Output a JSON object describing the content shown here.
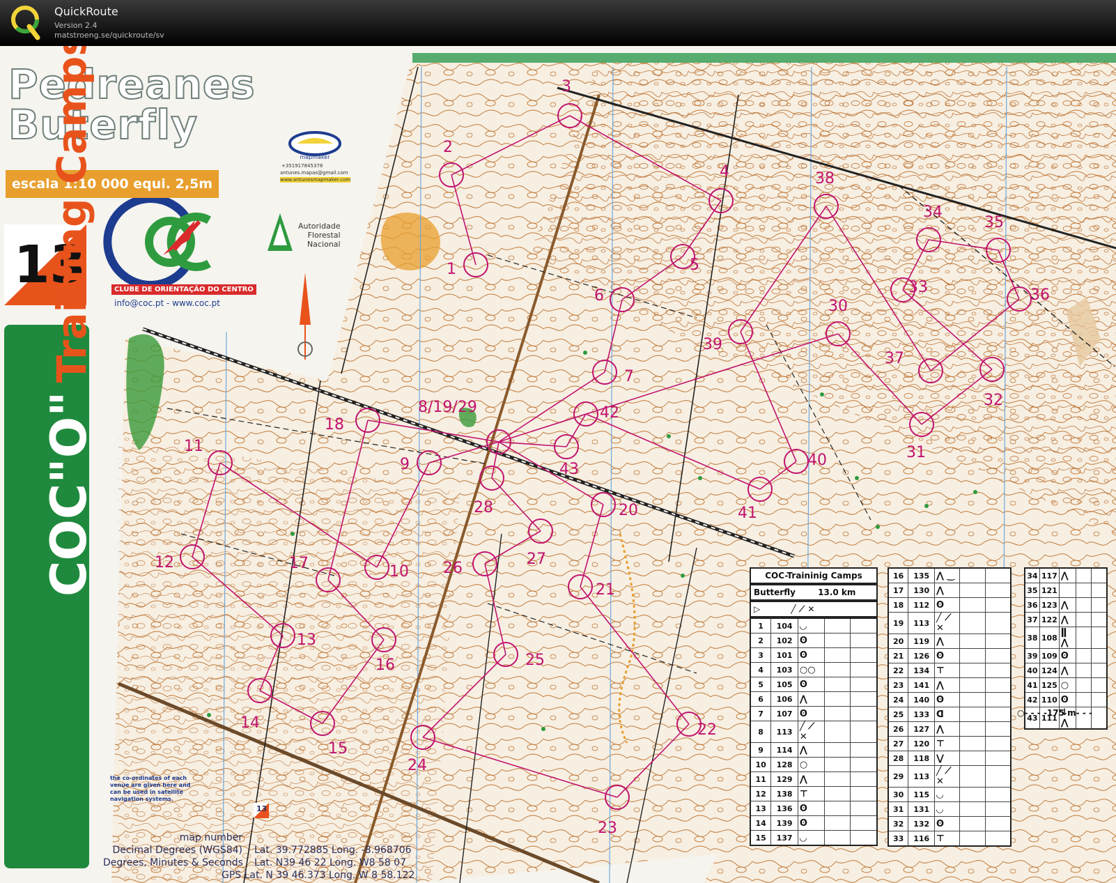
{
  "app": {
    "name": "QuickRoute",
    "version": "Version 2.4",
    "url": "matstroeng.se/quickroute/sv",
    "logo_icon": "quickroute-q-logo-icon"
  },
  "map": {
    "title_line1": "Pedreanes",
    "title_line2": "Buterfly",
    "scale_text": "escala 1:10 000  equi. 2,5m",
    "map_number": "13",
    "club": {
      "caption_prefix": "CLUBE DE ",
      "caption_rest": "ORIENTAÇÃO DO CENTRO",
      "contact": "info@coc.pt  -  www.coc.pt"
    },
    "authority": {
      "line1": "Autoridade",
      "line2": "Florestal",
      "line3": "Nacional"
    },
    "mapmaker": {
      "phone": "+351917845378",
      "email": "antunes.mapas@gmail.com",
      "web": "www.antunesmapmaker.com"
    },
    "banner": {
      "brand": "COC\"O\"",
      "rest": "Training Camps"
    },
    "coord_note": "the co-ordinates of each venue are given here and can be used in satellite navigation systems.",
    "coords": {
      "map_number_label": "map number",
      "map_number_value": "13",
      "decimal_label": "Decimal Degrees (WGS84)",
      "decimal_value": "Lat. 39.772885  Long. -8.968706",
      "dms_label": "Degrees, Minutes & Seconds",
      "dms_value": "Lat. N39 46 22  Long. W8 58 07",
      "gps_value": "GPS Lat. N 39 46.373  Long. W 8 58.122"
    },
    "colors": {
      "course": "#c0136e",
      "contour": "#b5651d",
      "vegetation": "#2f9b3f",
      "orange": "#e89f2e"
    }
  },
  "controls": [
    {
      "n": "1",
      "label": "1"
    },
    {
      "n": "2",
      "label": "2"
    },
    {
      "n": "3",
      "label": "3"
    },
    {
      "n": "4",
      "label": "4"
    },
    {
      "n": "5",
      "label": "5"
    },
    {
      "n": "6",
      "label": "6"
    },
    {
      "n": "7",
      "label": "7"
    },
    {
      "n": "8",
      "label": "8/19/29"
    },
    {
      "n": "9",
      "label": "9"
    },
    {
      "n": "10",
      "label": "10"
    },
    {
      "n": "11",
      "label": "11"
    },
    {
      "n": "12",
      "label": "12"
    },
    {
      "n": "13",
      "label": "13"
    },
    {
      "n": "14",
      "label": "14"
    },
    {
      "n": "15",
      "label": "15"
    },
    {
      "n": "16",
      "label": "16"
    },
    {
      "n": "17",
      "label": "17"
    },
    {
      "n": "18",
      "label": "18"
    },
    {
      "n": "20",
      "label": "20"
    },
    {
      "n": "21",
      "label": "21"
    },
    {
      "n": "22",
      "label": "22"
    },
    {
      "n": "23",
      "label": "23"
    },
    {
      "n": "24",
      "label": "24"
    },
    {
      "n": "25",
      "label": "25"
    },
    {
      "n": "26",
      "label": "26"
    },
    {
      "n": "27",
      "label": "27"
    },
    {
      "n": "28",
      "label": "28"
    },
    {
      "n": "30",
      "label": "30"
    },
    {
      "n": "31",
      "label": "31"
    },
    {
      "n": "32",
      "label": "32"
    },
    {
      "n": "33",
      "label": "33"
    },
    {
      "n": "34",
      "label": "34"
    },
    {
      "n": "35",
      "label": "35"
    },
    {
      "n": "36",
      "label": "36"
    },
    {
      "n": "37",
      "label": "37"
    },
    {
      "n": "38",
      "label": "38"
    },
    {
      "n": "39",
      "label": "39"
    },
    {
      "n": "40",
      "label": "40"
    },
    {
      "n": "41",
      "label": "41"
    },
    {
      "n": "42",
      "label": "42"
    },
    {
      "n": "43",
      "label": "43"
    }
  ],
  "descriptions": {
    "header_title": "COC-Traininig Camps",
    "course_name": "Butterfly",
    "course_length": "13.0 km",
    "start_symbol": "▷",
    "table1": [
      [
        "1",
        "104",
        "◡"
      ],
      [
        "2",
        "102",
        "ʘ"
      ],
      [
        "3",
        "101",
        "ʘ"
      ],
      [
        "4",
        "103",
        "○○"
      ],
      [
        "5",
        "105",
        "ʘ"
      ],
      [
        "6",
        "106",
        "⋀"
      ],
      [
        "7",
        "107",
        "ʘ"
      ],
      [
        "8",
        "113",
        "╱ ⟋ ✕"
      ],
      [
        "9",
        "114",
        "⋀"
      ],
      [
        "10",
        "128",
        "○"
      ],
      [
        "11",
        "129",
        "⋀"
      ],
      [
        "12",
        "138",
        "⊤"
      ],
      [
        "13",
        "136",
        "ʘ"
      ],
      [
        "14",
        "139",
        "ʘ"
      ],
      [
        "15",
        "137",
        "◡"
      ]
    ],
    "table2": [
      [
        "16",
        "135",
        "⋀ ‿"
      ],
      [
        "17",
        "130",
        "⋀"
      ],
      [
        "18",
        "112",
        "ʘ"
      ],
      [
        "19",
        "113",
        "╱ ⟋ ✕"
      ],
      [
        "20",
        "119",
        "⋀"
      ],
      [
        "21",
        "126",
        "ʘ"
      ],
      [
        "22",
        "134",
        "⊤"
      ],
      [
        "23",
        "141",
        "⋀"
      ],
      [
        "24",
        "140",
        "ʘ"
      ],
      [
        "25",
        "133",
        "ᗡ"
      ],
      [
        "26",
        "127",
        "⋀"
      ],
      [
        "27",
        "120",
        "⊤"
      ],
      [
        "28",
        "118",
        "⋁"
      ],
      [
        "29",
        "113",
        "╱ ⟋ ✕"
      ],
      [
        "30",
        "115",
        "◡"
      ],
      [
        "31",
        "131",
        "◡"
      ],
      [
        "32",
        "132",
        "ʘ"
      ],
      [
        "33",
        "116",
        "⊤"
      ]
    ],
    "table3": [
      [
        "34",
        "117",
        "⋀"
      ],
      [
        "35",
        "121",
        ""
      ],
      [
        "36",
        "123",
        "⋀"
      ],
      [
        "37",
        "122",
        "⋀"
      ],
      [
        "38",
        "108",
        "ǁ ⋀"
      ],
      [
        "39",
        "109",
        "ʘ"
      ],
      [
        "40",
        "124",
        "⋀"
      ],
      [
        "41",
        "125",
        "○"
      ],
      [
        "42",
        "110",
        "ʘ"
      ],
      [
        "43",
        "111",
        "↓ ⋀"
      ]
    ],
    "finish_text": "○- - - -175 m- - -"
  }
}
